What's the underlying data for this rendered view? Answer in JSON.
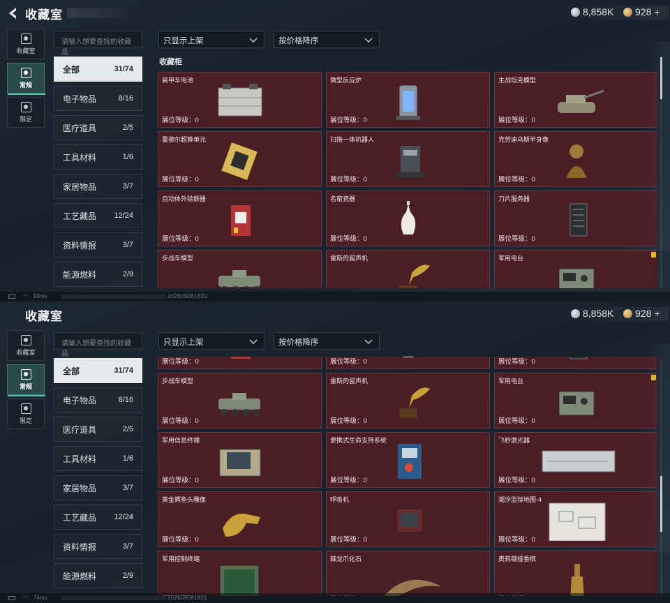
{
  "header": {
    "title": "收藏室"
  },
  "currency": {
    "silver": "8,858K",
    "gold": "928",
    "gold_plus": "+"
  },
  "category_tabs": [
    {
      "label": "收藏室",
      "icon": "collection-room-icon"
    },
    {
      "label": "常规",
      "icon": "regular-icon",
      "active": true
    },
    {
      "label": "限定",
      "icon": "limited-icon"
    }
  ],
  "search": {
    "placeholder": "请输入想要查找的收藏品"
  },
  "filters": {
    "shelf_filter": "只显示上架",
    "sort_order": "按价格降序"
  },
  "subcategories": [
    {
      "label": "全部",
      "count": "31/74",
      "active": true
    },
    {
      "label": "电子物品",
      "count": "8/16"
    },
    {
      "label": "医疗道具",
      "count": "2/5"
    },
    {
      "label": "工具材料",
      "count": "1/6"
    },
    {
      "label": "家居物品",
      "count": "3/7"
    },
    {
      "label": "工艺藏品",
      "count": "12/24"
    },
    {
      "label": "资料情报",
      "count": "3/7"
    },
    {
      "label": "能源燃料",
      "count": "2/9"
    }
  ],
  "section_title": "收藏柜",
  "level_label": "展位等级：0",
  "items": [
    {
      "name": "装甲车电池",
      "art": "armored-battery"
    },
    {
      "name": "微型反应炉",
      "art": "reactor"
    },
    {
      "name": "主战坦克模型",
      "art": "tank"
    },
    {
      "name": "曼德尔超算单元",
      "art": "chip"
    },
    {
      "name": "扫拖一体机器人",
      "art": "robot-vacuum"
    },
    {
      "name": "克劳迪乌斯半身像",
      "art": "bust"
    },
    {
      "name": "自动体外除颤器",
      "art": "defibrillator"
    },
    {
      "name": "名窑瓷器",
      "art": "porcelain"
    },
    {
      "name": "刀片服务器",
      "art": "server"
    },
    {
      "name": "步战车模型",
      "art": "ifv"
    },
    {
      "name": "雷斯的留声机",
      "art": "gramophone"
    },
    {
      "name": "军用电台",
      "art": "radio",
      "badge": true
    },
    {
      "name": "军用信息终端",
      "art": "terminal"
    },
    {
      "name": "便携式生命支持系统",
      "art": "life-support"
    },
    {
      "name": "飞秒激光器",
      "art": "laser"
    },
    {
      "name": "黄金鳄鱼头雕像",
      "art": "gold-croc"
    },
    {
      "name": "呼吸机",
      "art": "ventilator"
    },
    {
      "name": "潮汐监狱地图-4",
      "art": "map"
    },
    {
      "name": "军用控制终端",
      "art": "control-terminal"
    },
    {
      "name": "棘龙爪化石",
      "art": "claw-fossil"
    },
    {
      "name": "奥莉薇娅香槟",
      "art": "champagne"
    }
  ],
  "status": {
    "ping_top": "90ms",
    "stamp_top": "202609081820",
    "ping_bottom": "74ms",
    "stamp_bottom": "202609081821"
  }
}
